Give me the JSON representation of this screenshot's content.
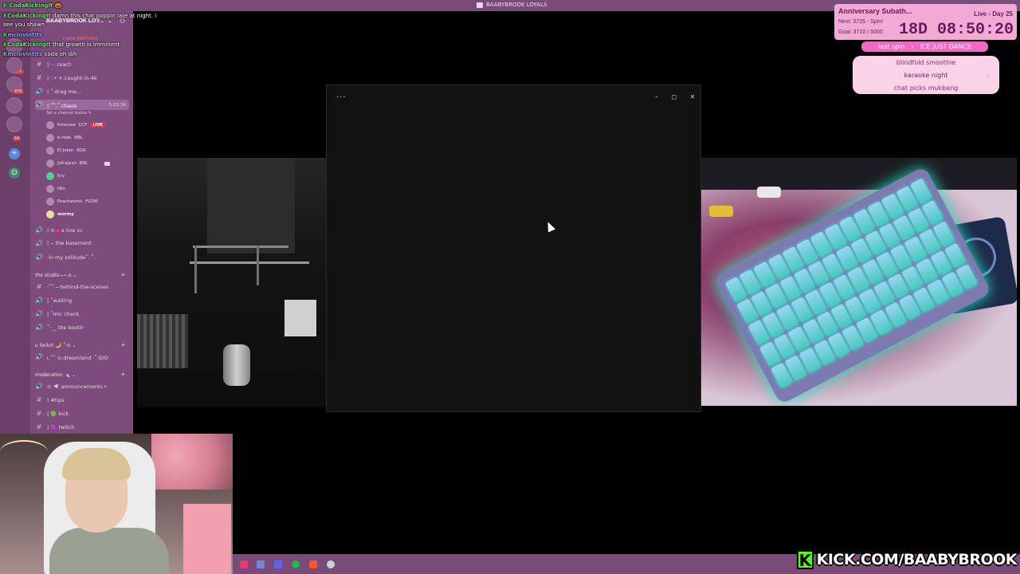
{
  "topbar": {
    "title": "BAABYBROOK LOYALS"
  },
  "chat": [
    {
      "k": "K",
      "name": "-CodaKickingIt",
      "msg": "🎃"
    },
    {
      "k": "K",
      "name": "CodaKickingIt",
      "msg": "damn this chat poppin late at night. i"
    },
    {
      "k": "",
      "name": "",
      "msg": "see you shawn"
    },
    {
      "k": "K",
      "name": "mclovintits",
      "msg": ""
    },
    {
      "k": "K",
      "name": "CodaKickingIt",
      "msg": "that growth is imminent"
    },
    {
      "k": "K",
      "name": "mclovintits",
      "msg": "coda oh dih"
    }
  ],
  "sidebar": {
    "guild_name": "BAABYBROOK LOY...",
    "new_mentions": "2 NEW MENTIONS",
    "server_badges": [
      "957",
      "476",
      "64"
    ],
    "channels_top": [
      {
        "icon": "#",
        "label": "| ·-·.react·"
      },
      {
        "icon": "#",
        "label": "| ·.•·+.caught-in-4k"
      },
      {
        "icon": "🔊",
        "label": "| ˚·drag me..."
      }
    ],
    "active_voice": {
      "label": "| ⌒.˚ chaos",
      "time": "5:11:34",
      "status": "Set a channel status ✎"
    },
    "members": [
      {
        "name": "Kmonee",
        "tag": "CCF",
        "live": "LIVE"
      },
      {
        "name": "b·rook",
        "tag": "BBL",
        "live": ""
      },
      {
        "name": "El Joker",
        "tag": "KOA",
        "live": ""
      },
      {
        "name": "Jafrajaxz",
        "tag": "BBL",
        "live": ""
      },
      {
        "name": "Kry",
        "tag": "",
        "live": ""
      },
      {
        "name": "Idiv",
        "tag": "",
        "live": ""
      },
      {
        "name": "Peachesmk",
        "tag": "FLOW",
        "live": ""
      },
      {
        "name": "wormy",
        "tag": "",
        "live": ""
      }
    ],
    "channels_mid": [
      {
        "icon": "🔊",
        "label": "| ⊙💗a live vc"
      },
      {
        "icon": "🔊",
        "label": "| ⌣ the basement"
      },
      {
        "icon": "🔊",
        "label": "·in my solitude˚.·˚."
      }
    ],
    "category_studio": "the studio—⋆.ο ⌄",
    "channels_studio": [
      {
        "icon": "#",
        "label": "·⌒.⌣·behind-the-scenes"
      },
      {
        "icon": "🔊",
        "label": "| ˚waiting"
      },
      {
        "icon": "🔊",
        "label": "| ˚mic check"
      },
      {
        "icon": "🔊",
        "label": "˚·__ the booth·"
      }
    ],
    "category_lockin": "u lockin 🌙 ˚·⊙ ⌄",
    "channels_lockin": [
      {
        "icon": "🔊",
        "label": "ι ⌒ ⊙.dreamland ·˚.GIO"
      }
    ],
    "category_mod": "moderation 🔪 ⌄",
    "channels_mod": [
      {
        "icon": "🔊",
        "label": "⊙ 📢 announcements⚬"
      },
      {
        "icon": "#",
        "label": "| #tips"
      },
      {
        "icon": "#",
        "label": "| 🟢 kick"
      },
      {
        "icon": "#",
        "label": "| 🟣 twitch"
      }
    ]
  },
  "window": {
    "menu_label": "···",
    "minimize": "–",
    "maximize": "◻",
    "close": "✕"
  },
  "subathon": {
    "title": "Anniversary Subath...",
    "live": "Live - Day 25",
    "next": "Next: 3725 - Spin!",
    "goal": "Goal: 3710 / 5000",
    "timer": "18D 08:50:20"
  },
  "spin": {
    "last_label": "last spin",
    "last_value": "ICE JUST DANCE",
    "items": [
      "blindfold smoothie",
      "karaoke night",
      "chat picks mukbang"
    ]
  },
  "brand": {
    "letter": "K",
    "text": "KICK.COM/BAABYBROOK"
  },
  "taskbar_icons": [
    {
      "name": "tiktok-icon",
      "color": "#e23b6c"
    },
    {
      "name": "app-icon",
      "color": "#6b8bd6"
    },
    {
      "name": "discord-icon",
      "color": "#5865f2"
    },
    {
      "name": "spotify-icon",
      "color": "#1db954"
    },
    {
      "name": "brave-icon",
      "color": "#fb542b"
    },
    {
      "name": "steam-icon",
      "color": "#c7d5e0"
    }
  ]
}
